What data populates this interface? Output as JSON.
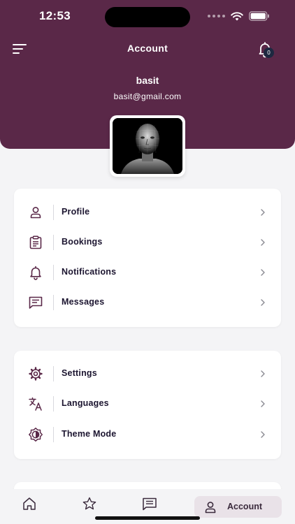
{
  "status_bar": {
    "time": "12:53"
  },
  "header": {
    "title": "Account",
    "notification_count": "0",
    "user_name": "basit",
    "user_email": "basit@gmail.com"
  },
  "menu_group_1": [
    {
      "label": "Profile",
      "icon": "person-icon"
    },
    {
      "label": "Bookings",
      "icon": "clipboard-icon"
    },
    {
      "label": "Notifications",
      "icon": "bell-icon"
    },
    {
      "label": "Messages",
      "icon": "message-icon"
    }
  ],
  "menu_group_2": [
    {
      "label": "Settings",
      "icon": "gear-icon"
    },
    {
      "label": "Languages",
      "icon": "translate-icon"
    },
    {
      "label": "Theme Mode",
      "icon": "theme-icon"
    }
  ],
  "tab_bar": {
    "active_label": "Account",
    "tabs": [
      "home-icon",
      "star-icon",
      "message-icon",
      "person-icon"
    ]
  },
  "colors": {
    "header_bg": "#5a2848",
    "icon_color": "#5a2848",
    "background": "#f4f4f6",
    "active_tab_bg": "#e9e2e8"
  }
}
